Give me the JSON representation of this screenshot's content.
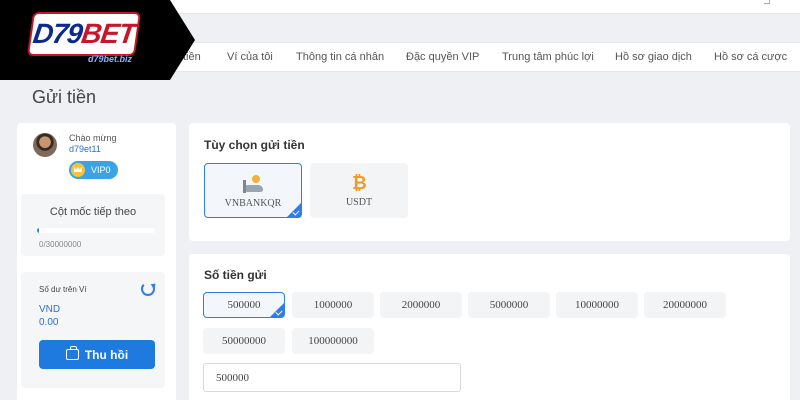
{
  "brand": {
    "logo_text_main": "D79",
    "logo_text_accent": "BET",
    "logo_url": "d79bet.biz"
  },
  "nav": {
    "items": [
      {
        "label": "tiền"
      },
      {
        "label": "Ví của tôi"
      },
      {
        "label": "Thông tin cá nhân"
      },
      {
        "label": "Đặc quyền VIP"
      },
      {
        "label": "Trung tâm phúc lợi"
      },
      {
        "label": "Hồ sơ giao dịch"
      },
      {
        "label": "Hồ sơ cá cược"
      }
    ]
  },
  "page": {
    "title": "Gửi tiền"
  },
  "profile": {
    "greeting": "Chào mừng",
    "username": "d79et11",
    "vip_label": "VIP0",
    "milestone_title": "Cột mốc tiếp theo",
    "milestone_value": "0/30000000",
    "milestone_progress": 0.02
  },
  "wallet": {
    "label": "Số dư trên Ví",
    "currency": "VND",
    "amount": "0.00",
    "withdraw_label": "Thu hồi"
  },
  "deposit_options": {
    "title": "Tùy chọn gửi tiền",
    "methods": [
      {
        "label": "VNBANKQR",
        "icon": "bank-transfer-icon",
        "selected": true
      },
      {
        "label": "USDT",
        "icon": "bitcoin-icon",
        "selected": false
      }
    ]
  },
  "deposit_amount": {
    "title": "Số tiền gửi",
    "presets": [
      "500000",
      "1000000",
      "2000000",
      "5000000",
      "10000000",
      "20000000",
      "50000000",
      "100000000"
    ],
    "selected_preset": "500000",
    "input_value": "500000"
  },
  "colors": {
    "accent": "#2f7ee8",
    "brand_red": "#c5162a",
    "brand_blue": "#0d2a8a"
  }
}
